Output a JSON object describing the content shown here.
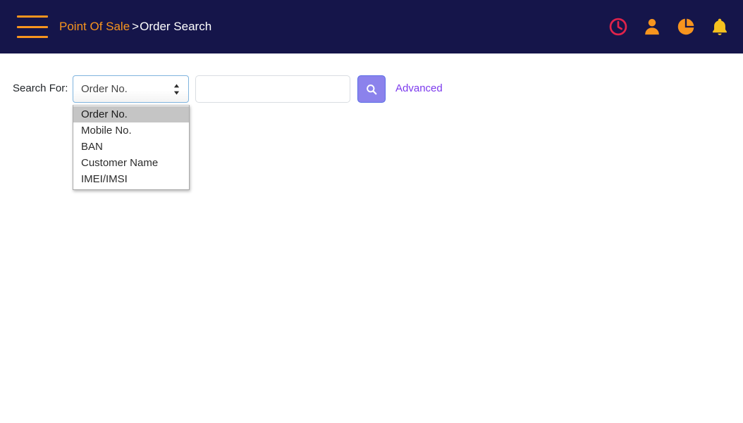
{
  "header": {
    "menu_icon": "hamburger-menu-icon",
    "breadcrumb": {
      "root": "Point Of Sale",
      "separator": ">",
      "current": "Order Search"
    },
    "icons": [
      {
        "name": "clock-icon",
        "color": "#e0234b"
      },
      {
        "name": "user-icon",
        "color": "#f7941e"
      },
      {
        "name": "pie-chart-icon",
        "color": "#f7941e"
      },
      {
        "name": "bell-icon",
        "color": "#f5c11e"
      }
    ],
    "background": "#15154a",
    "brand_color": "#f7941e"
  },
  "search": {
    "label": "Search For:",
    "select": {
      "name": "search-type-select",
      "selected": "Order No.",
      "expanded": true,
      "options": [
        "Order No.",
        "Mobile No.",
        "BAN",
        "Customer Name",
        "IMEI/IMSI"
      ],
      "selected_index": 0
    },
    "text_input": {
      "name": "search-term-input",
      "value": "",
      "placeholder": ""
    },
    "button": {
      "name": "search-button",
      "icon": "search-icon",
      "label": "",
      "color": "#8b82ec"
    },
    "advanced_link": {
      "label": "Advanced",
      "color": "#7c3aed"
    }
  }
}
